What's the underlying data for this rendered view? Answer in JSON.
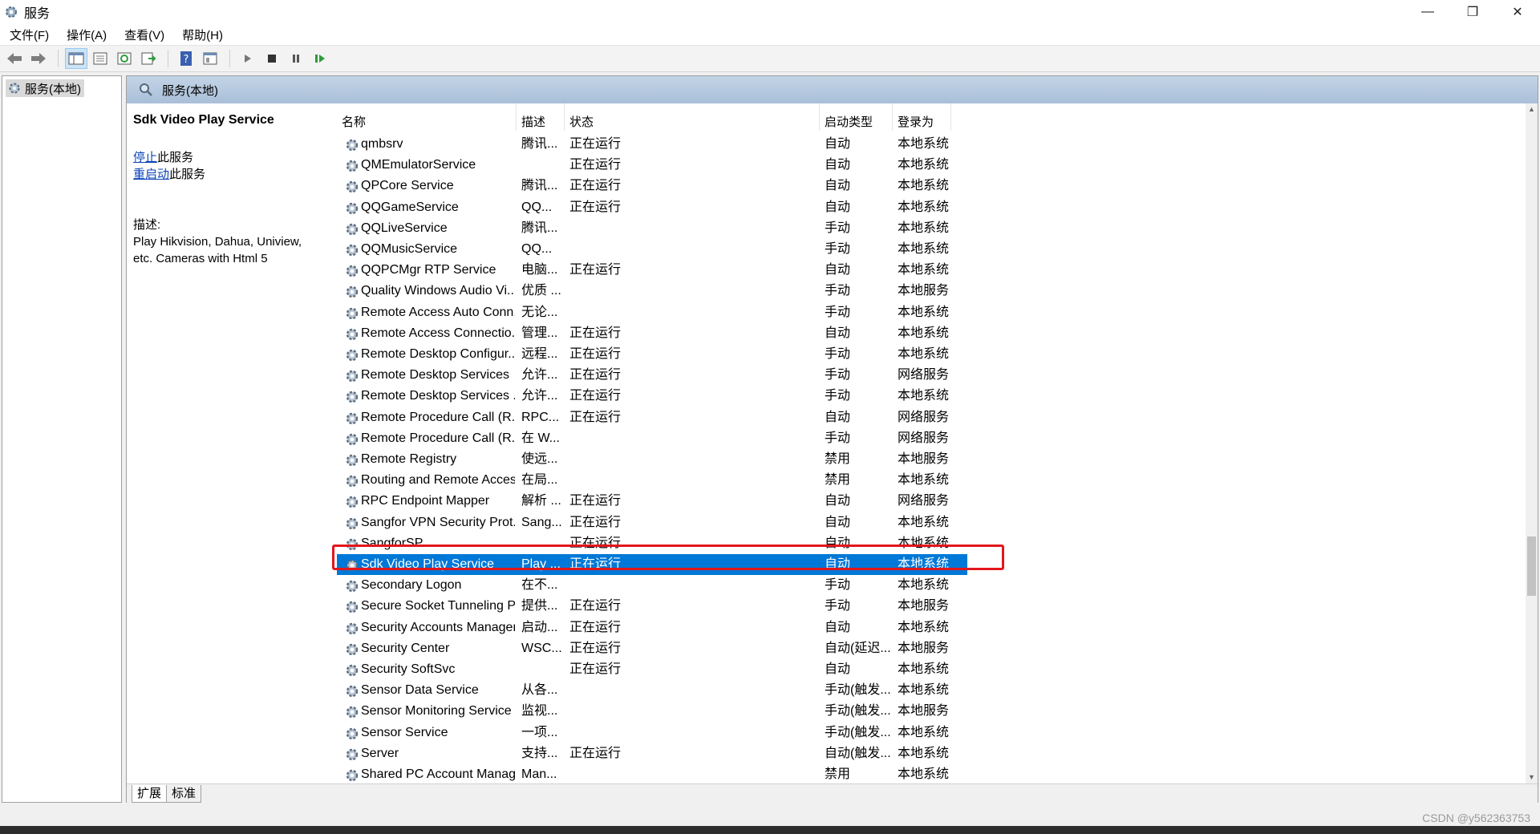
{
  "window": {
    "title": "服务"
  },
  "menu": [
    "文件(F)",
    "操作(A)",
    "查看(V)",
    "帮助(H)"
  ],
  "tree": {
    "root_label": "服务(本地)"
  },
  "banner": {
    "label": "服务(本地)"
  },
  "detail": {
    "service_name": "Sdk Video Play Service",
    "stop_link": "停止",
    "stop_suffix": "此服务",
    "restart_link": "重启动",
    "restart_suffix": "此服务",
    "desc_heading": "描述:",
    "desc_line1": "Play Hikvision, Dahua, Uniview,",
    "desc_line2": "etc. Cameras with Html 5"
  },
  "columns": {
    "name": "名称",
    "desc": "描述",
    "status": "状态",
    "startup": "启动类型",
    "logon": "登录为"
  },
  "services": [
    {
      "name": "qmbsrv",
      "desc": "腾讯...",
      "status": "正在运行",
      "startup": "自动",
      "logon": "本地系统"
    },
    {
      "name": "QMEmulatorService",
      "desc": "",
      "status": "正在运行",
      "startup": "自动",
      "logon": "本地系统"
    },
    {
      "name": "QPCore Service",
      "desc": "腾讯...",
      "status": "正在运行",
      "startup": "自动",
      "logon": "本地系统"
    },
    {
      "name": "QQGameService",
      "desc": "QQ...",
      "status": "正在运行",
      "startup": "自动",
      "logon": "本地系统"
    },
    {
      "name": "QQLiveService",
      "desc": "腾讯...",
      "status": "",
      "startup": "手动",
      "logon": "本地系统"
    },
    {
      "name": "QQMusicService",
      "desc": "QQ...",
      "status": "",
      "startup": "手动",
      "logon": "本地系统"
    },
    {
      "name": "QQPCMgr RTP Service",
      "desc": "电脑...",
      "status": "正在运行",
      "startup": "自动",
      "logon": "本地系统"
    },
    {
      "name": "Quality Windows Audio Vi...",
      "desc": "优质 ...",
      "status": "",
      "startup": "手动",
      "logon": "本地服务"
    },
    {
      "name": "Remote Access Auto Conn...",
      "desc": "无论...",
      "status": "",
      "startup": "手动",
      "logon": "本地系统"
    },
    {
      "name": "Remote Access Connectio...",
      "desc": "管理...",
      "status": "正在运行",
      "startup": "自动",
      "logon": "本地系统"
    },
    {
      "name": "Remote Desktop Configur...",
      "desc": "远程...",
      "status": "正在运行",
      "startup": "手动",
      "logon": "本地系统"
    },
    {
      "name": "Remote Desktop Services",
      "desc": "允许...",
      "status": "正在运行",
      "startup": "手动",
      "logon": "网络服务"
    },
    {
      "name": "Remote Desktop Services ...",
      "desc": "允许...",
      "status": "正在运行",
      "startup": "手动",
      "logon": "本地系统"
    },
    {
      "name": "Remote Procedure Call (R...",
      "desc": "RPC...",
      "status": "正在运行",
      "startup": "自动",
      "logon": "网络服务"
    },
    {
      "name": "Remote Procedure Call (R...",
      "desc": "在 W...",
      "status": "",
      "startup": "手动",
      "logon": "网络服务"
    },
    {
      "name": "Remote Registry",
      "desc": "使远...",
      "status": "",
      "startup": "禁用",
      "logon": "本地服务"
    },
    {
      "name": "Routing and Remote Access",
      "desc": "在局...",
      "status": "",
      "startup": "禁用",
      "logon": "本地系统"
    },
    {
      "name": "RPC Endpoint Mapper",
      "desc": "解析 ...",
      "status": "正在运行",
      "startup": "自动",
      "logon": "网络服务"
    },
    {
      "name": "Sangfor VPN Security Prot...",
      "desc": "Sang...",
      "status": "正在运行",
      "startup": "自动",
      "logon": "本地系统"
    },
    {
      "name": "SangforSP",
      "desc": "",
      "status": "正在运行",
      "startup": "自动",
      "logon": "本地系统"
    },
    {
      "name": "Sdk Video Play Service",
      "desc": "Play ...",
      "status": "正在运行",
      "startup": "自动",
      "logon": "本地系统",
      "selected": true
    },
    {
      "name": "Secondary Logon",
      "desc": "在不...",
      "status": "",
      "startup": "手动",
      "logon": "本地系统"
    },
    {
      "name": "Secure Socket Tunneling P...",
      "desc": "提供...",
      "status": "正在运行",
      "startup": "手动",
      "logon": "本地服务"
    },
    {
      "name": "Security Accounts Manager",
      "desc": "启动...",
      "status": "正在运行",
      "startup": "自动",
      "logon": "本地系统"
    },
    {
      "name": "Security Center",
      "desc": "WSC...",
      "status": "正在运行",
      "startup": "自动(延迟...",
      "logon": "本地服务"
    },
    {
      "name": "Security SoftSvc",
      "desc": "",
      "status": "正在运行",
      "startup": "自动",
      "logon": "本地系统"
    },
    {
      "name": "Sensor Data Service",
      "desc": "从各...",
      "status": "",
      "startup": "手动(触发...",
      "logon": "本地系统"
    },
    {
      "name": "Sensor Monitoring Service",
      "desc": "监视...",
      "status": "",
      "startup": "手动(触发...",
      "logon": "本地服务"
    },
    {
      "name": "Sensor Service",
      "desc": "一项...",
      "status": "",
      "startup": "手动(触发...",
      "logon": "本地系统"
    },
    {
      "name": "Server",
      "desc": "支持...",
      "status": "正在运行",
      "startup": "自动(触发...",
      "logon": "本地系统"
    },
    {
      "name": "Shared PC Account Manager",
      "desc": "Man...",
      "status": "",
      "startup": "禁用",
      "logon": "本地系统"
    }
  ],
  "tabs": {
    "extended": "扩展",
    "standard": "标准"
  },
  "watermark": "CSDN @y562363753",
  "colors": {
    "selection": "#0078d7",
    "highlight_border": "#e3161c",
    "link": "#0b44b7"
  },
  "icons": [
    "gear-icon",
    "back-icon",
    "forward-icon",
    "start-icon",
    "stop-icon",
    "pause-icon",
    "restart-icon",
    "help-icon"
  ]
}
